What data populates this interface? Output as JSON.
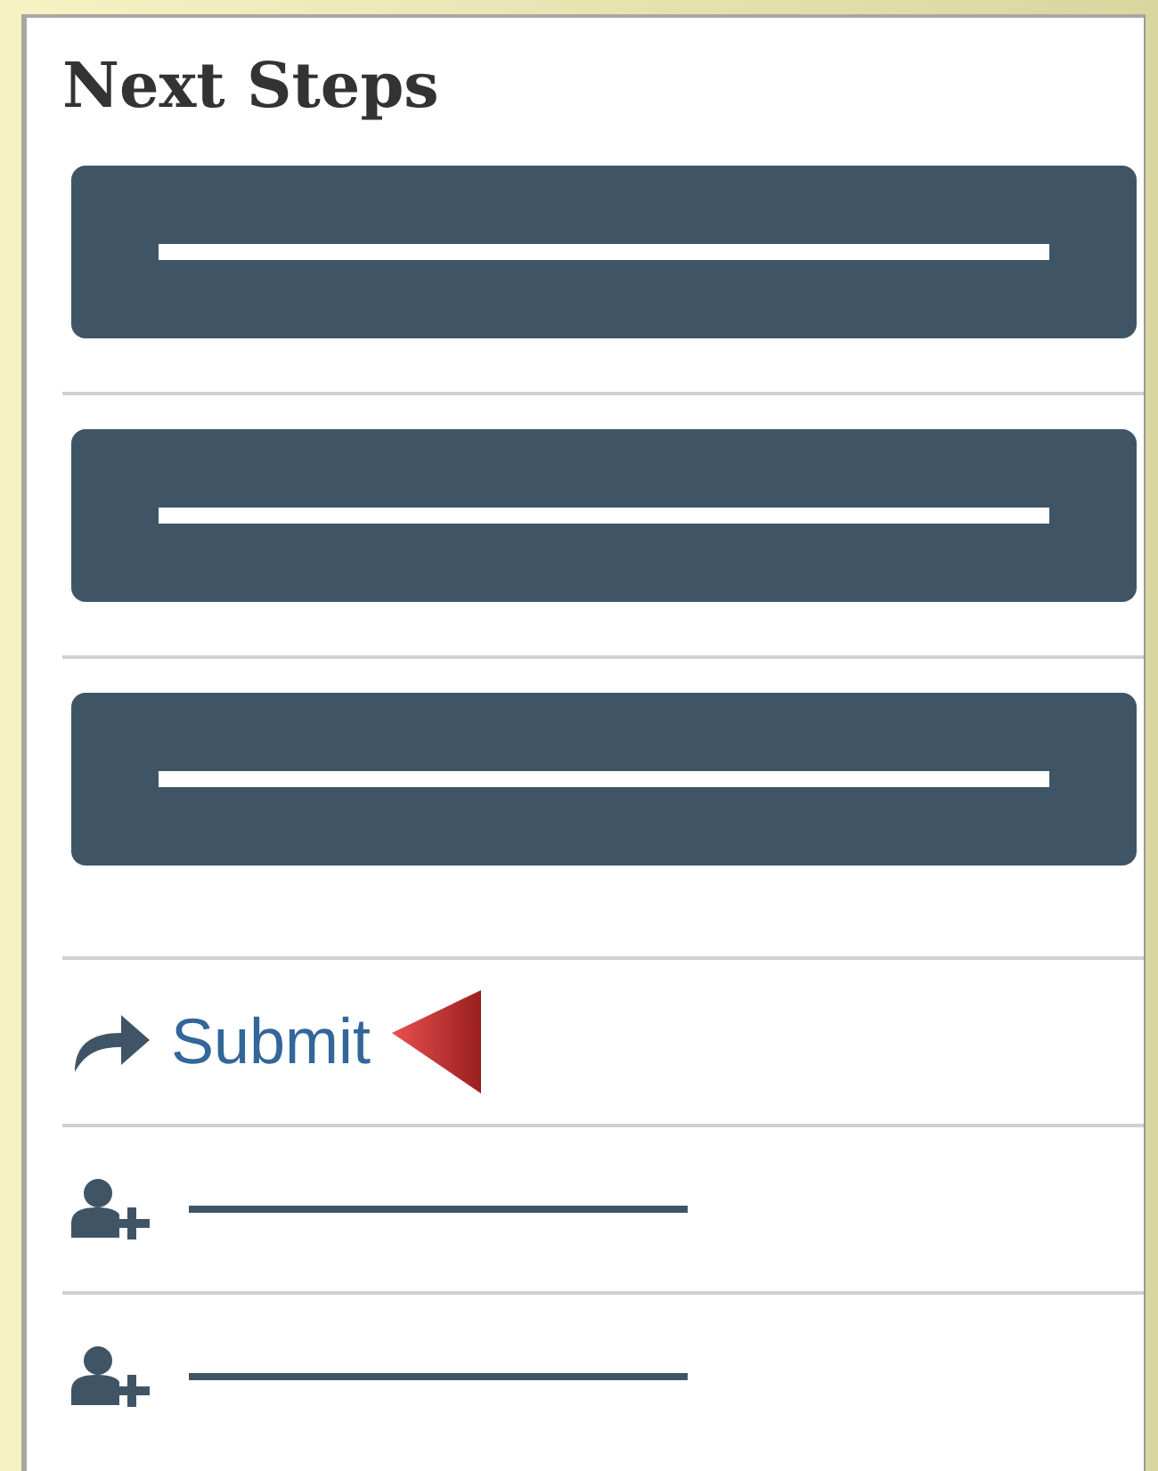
{
  "title": "Next Steps",
  "buttons": [
    {
      "kind": "redacted"
    },
    {
      "kind": "redacted"
    },
    {
      "kind": "redacted"
    }
  ],
  "links": [
    {
      "kind": "submit",
      "label": "Submit",
      "highlighted": true
    },
    {
      "kind": "add-person",
      "highlighted": false
    },
    {
      "kind": "add-person",
      "highlighted": false
    }
  ]
}
